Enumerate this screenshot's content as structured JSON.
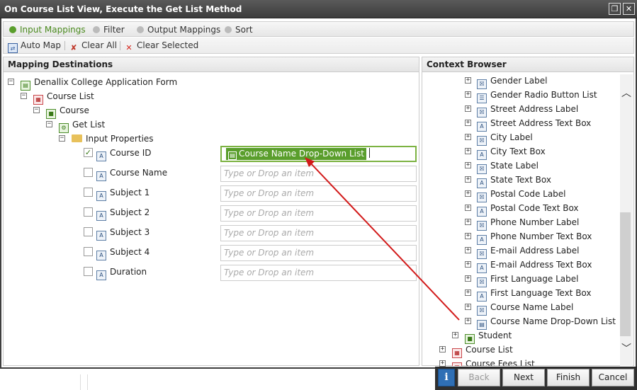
{
  "window": {
    "title": "On Course List View, Execute the Get List Method",
    "restore_icon": "restore-icon",
    "close_icon": "close-icon"
  },
  "tabs": [
    {
      "label": "Input Mappings",
      "active": true
    },
    {
      "label": "Filter",
      "active": false
    },
    {
      "label": "Output Mappings",
      "active": false
    },
    {
      "label": "Sort",
      "active": false
    }
  ],
  "toolbar": {
    "auto_map": "Auto Map",
    "clear_all": "Clear All",
    "clear_selected": "Clear Selected"
  },
  "left_panel": {
    "title": "Mapping Destinations",
    "tree": {
      "root": "Denallix College Application Form",
      "view": "Course List",
      "smartobject": "Course",
      "method": "Get List",
      "folder": "Input Properties"
    },
    "properties": [
      {
        "name": "Course ID",
        "checked": true,
        "value": "Course Name Drop-Down List"
      },
      {
        "name": "Course Name",
        "checked": false,
        "value": ""
      },
      {
        "name": "Subject 1",
        "checked": false,
        "value": ""
      },
      {
        "name": "Subject 2",
        "checked": false,
        "value": ""
      },
      {
        "name": "Subject 3",
        "checked": false,
        "value": ""
      },
      {
        "name": "Subject 4",
        "checked": false,
        "value": ""
      },
      {
        "name": "Duration",
        "checked": false,
        "value": ""
      }
    ],
    "placeholder": "Type or Drop an item"
  },
  "right_panel": {
    "title": "Context Browser",
    "items": [
      "Gender Label",
      "Gender Radio Button List",
      "Street Address Label",
      "Street Address Text Box",
      "City Label",
      "City Text Box",
      "State Label",
      "State Text Box",
      "Postal Code Label",
      "Postal Code Text Box",
      "Phone Number Label",
      "Phone Number Text Box",
      "E-mail Address Label",
      "E-mail Address Text Box",
      "First Language Label",
      "First Language Text Box",
      "Course Name Label",
      "Course Name Drop-Down List"
    ],
    "student": "Student",
    "course_list": "Course List",
    "course_fees_list": "Course Fees List"
  },
  "footer": {
    "back": "Back",
    "next": "Next",
    "finish": "Finish",
    "cancel": "Cancel"
  },
  "colors": {
    "accent": "#5a9e2c",
    "titlebar": "#3c3c3c",
    "arrow": "#d21a1a"
  }
}
